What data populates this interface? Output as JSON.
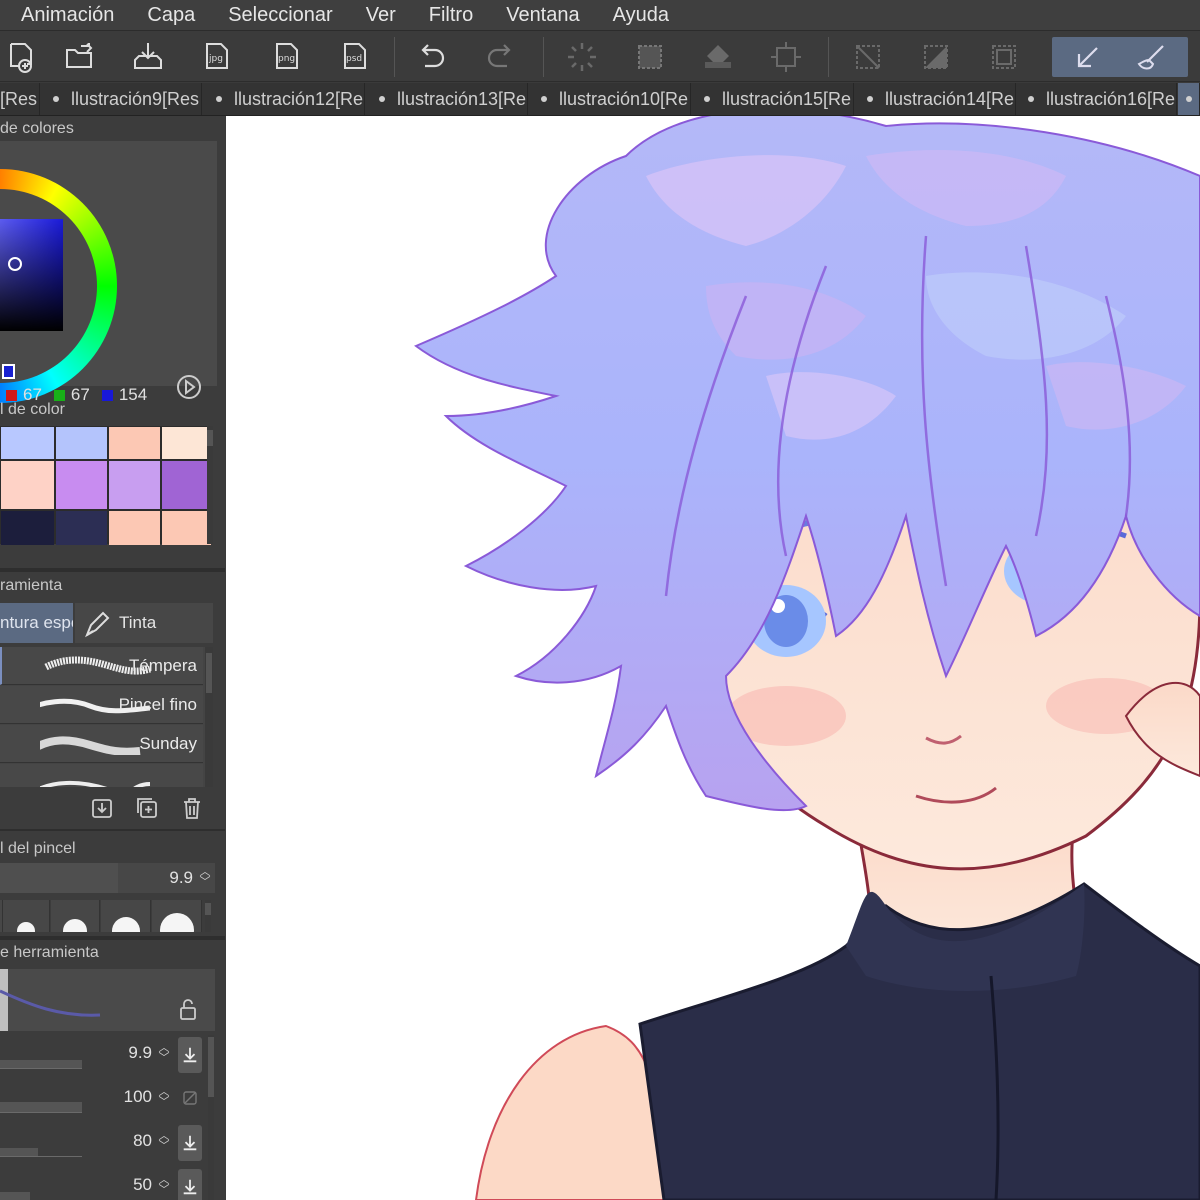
{
  "menu": [
    "Animación",
    "Capa",
    "Seleccionar",
    "Ver",
    "Filtro",
    "Ventana",
    "Ayuda"
  ],
  "toolbar": {
    "icons": [
      "new-file-icon",
      "open-file-icon",
      "save-icon",
      "export-jpg-icon",
      "export-png-icon",
      "export-psd-icon",
      "undo-icon",
      "redo-icon",
      "loading-icon",
      "selection-icon",
      "fill-icon",
      "transform-icon",
      "deselect-icon",
      "invert-selection-icon",
      "selection-border-icon",
      "pen-tool-icon",
      "brush-tool-icon"
    ],
    "jpg_label": "jpg",
    "png_label": "png",
    "psd_label": "psd"
  },
  "tabs": [
    {
      "label": "[Res"
    },
    {
      "label": "llustración9[Res"
    },
    {
      "label": "llustración12[Re"
    },
    {
      "label": "llustración13[Re"
    },
    {
      "label": "llustración10[Re"
    },
    {
      "label": "llustración15[Re"
    },
    {
      "label": "llustración14[Re"
    },
    {
      "label": "llustración16[Re"
    }
  ],
  "color_circle": {
    "title": "de colores",
    "r": "67",
    "g": "67",
    "b": "154",
    "r_color": "#d01818",
    "g_color": "#18b018",
    "b_color": "#1818d8"
  },
  "color_set": {
    "title": "l de color",
    "swatches": [
      "#b8c8ff",
      "#b4c4fc",
      "#fcc8b4",
      "#fde6d6",
      "#fed2c6",
      "#c88cf0",
      "#c89ef0",
      "#a064d4",
      "#1c1e3c",
      "#2c2e54",
      "#fcc8b4",
      "#fcc8b4",
      "#fcc8b4",
      "#4c5ea0",
      "#aac2ff"
    ]
  },
  "sub_tool": {
    "title": "ramienta",
    "tab_paint": "ntura espe",
    "tab_ink": "Tinta",
    "brushes": [
      "Témpera",
      "Pincel fino",
      "Sunday",
      ""
    ]
  },
  "brush_size": {
    "title": "l del pincel",
    "value": "9.9",
    "fill_fraction": 0.55
  },
  "tool_property": {
    "title": "e herramienta",
    "rows": [
      {
        "value": "9.9",
        "fill_fraction": 0.4
      },
      {
        "value": "100",
        "fill_fraction": 0.4
      },
      {
        "value": "80",
        "fill_fraction": 0.25
      },
      {
        "value": "50",
        "fill_fraction": 0.2
      }
    ]
  }
}
